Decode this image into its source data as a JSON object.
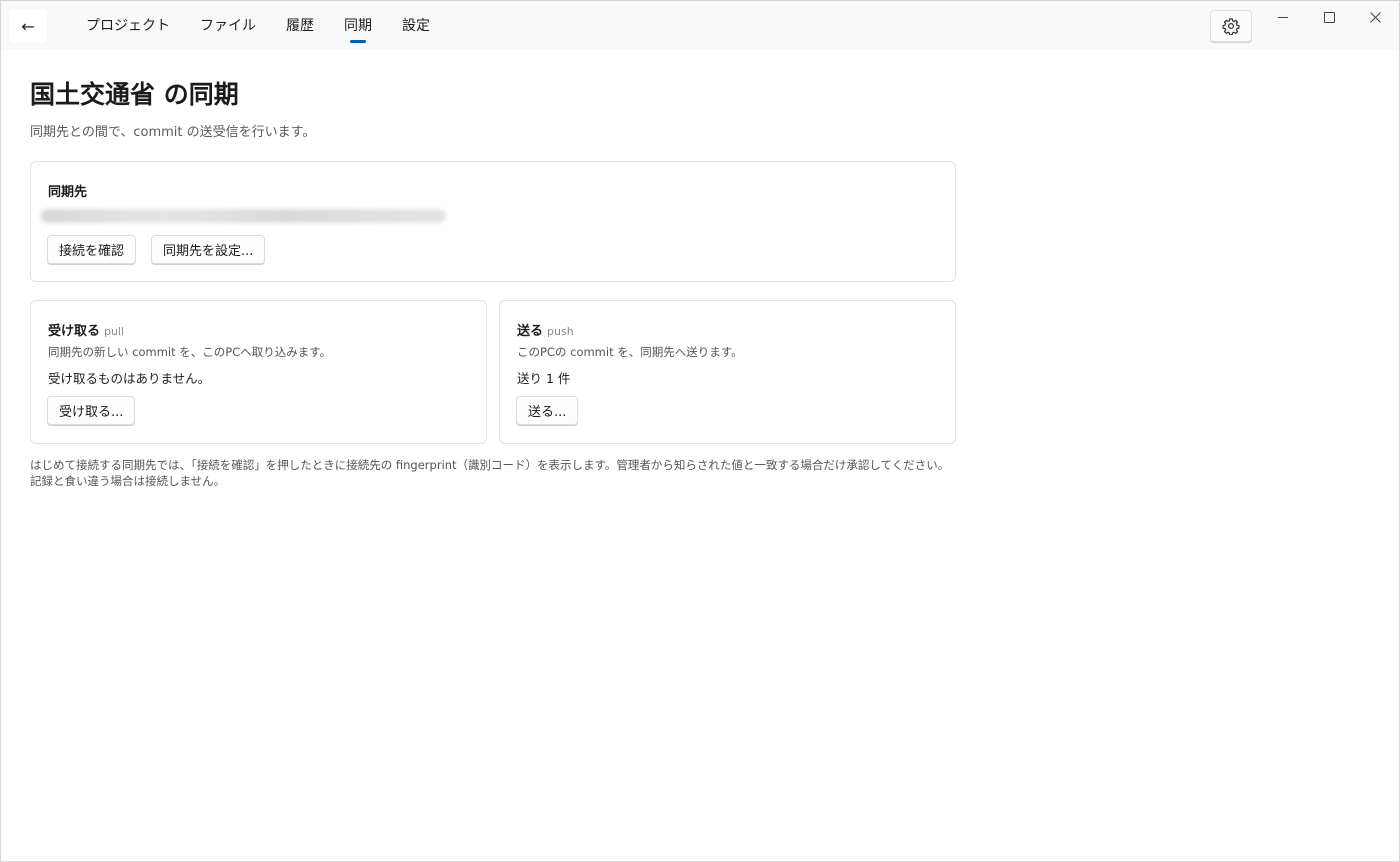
{
  "nav": {
    "back_label": "←",
    "tabs": [
      {
        "label": "プロジェクト",
        "active": false
      },
      {
        "label": "ファイル",
        "active": false
      },
      {
        "label": "履歴",
        "active": false
      },
      {
        "label": "同期",
        "active": true
      },
      {
        "label": "設定",
        "active": false
      }
    ],
    "settings_icon": "gear-icon",
    "accent_color": "#005fb8"
  },
  "window_controls": {
    "minimize_icon": "minimize-icon",
    "maximize_icon": "maximize-icon",
    "close_icon": "close-icon"
  },
  "page": {
    "title": "国土交通省 の同期",
    "subtitle": "同期先との間で、commit の送受信を行います。"
  },
  "remote_card": {
    "title": "同期先",
    "check_button": "接続を確認",
    "set_button": "同期先を設定..."
  },
  "pull_card": {
    "title": "受け取る",
    "tag": "pull",
    "desc": "同期先の新しい commit を、このPCへ取り込みます。",
    "status": "受け取るものはありません。",
    "button": "受け取る..."
  },
  "push_card": {
    "title": "送る",
    "tag": "push",
    "desc": "このPCの commit を、同期先へ送ります。",
    "status": "送り 1 件",
    "button": "送る..."
  },
  "notice": "はじめて接続する同期先では、「接続を確認」を押したときに接続先の fingerprint（識別コード）を表示します。管理者から知らされた値と一致する場合だけ承認してください。記録と食い違う場合は接続しません。"
}
